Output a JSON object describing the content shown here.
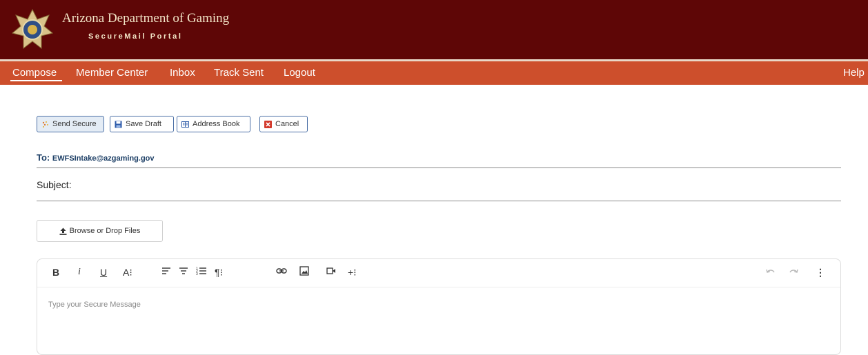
{
  "header": {
    "org_title": "Arizona Department of Gaming",
    "portal_name": "SecureMail Portal",
    "badge_icon": "gaming-department-badge",
    "background_color": "#5e0606"
  },
  "nav": {
    "color": "#cd4f2c",
    "items": [
      {
        "label": "Compose",
        "active": true
      },
      {
        "label": "Member Center"
      },
      {
        "label": "Inbox"
      },
      {
        "label": "Track Sent"
      },
      {
        "label": "Logout"
      }
    ],
    "help_label": "Help"
  },
  "toolbar": {
    "send_label": "Send Secure",
    "save_label": "Save Draft",
    "address_book_label": "Address Book",
    "cancel_label": "Cancel"
  },
  "message": {
    "to_label": "To:",
    "to_value": "EWFSIntake@azgaming.gov",
    "subject_label": "Subject:",
    "subject_value": ""
  },
  "attachments": {
    "upload_label": "Browse or Drop Files"
  },
  "editor": {
    "placeholder": "Type your Secure Message",
    "toolbar_icons": [
      "bold-icon",
      "italic-icon",
      "underline-icon",
      "font-size-icon",
      "align-left-icon",
      "align-center-icon",
      "ordered-list-icon",
      "paragraph-icon",
      "link-icon",
      "image-icon",
      "video-icon",
      "insert-more-icon",
      "undo-icon",
      "redo-icon",
      "more-options-icon"
    ]
  }
}
